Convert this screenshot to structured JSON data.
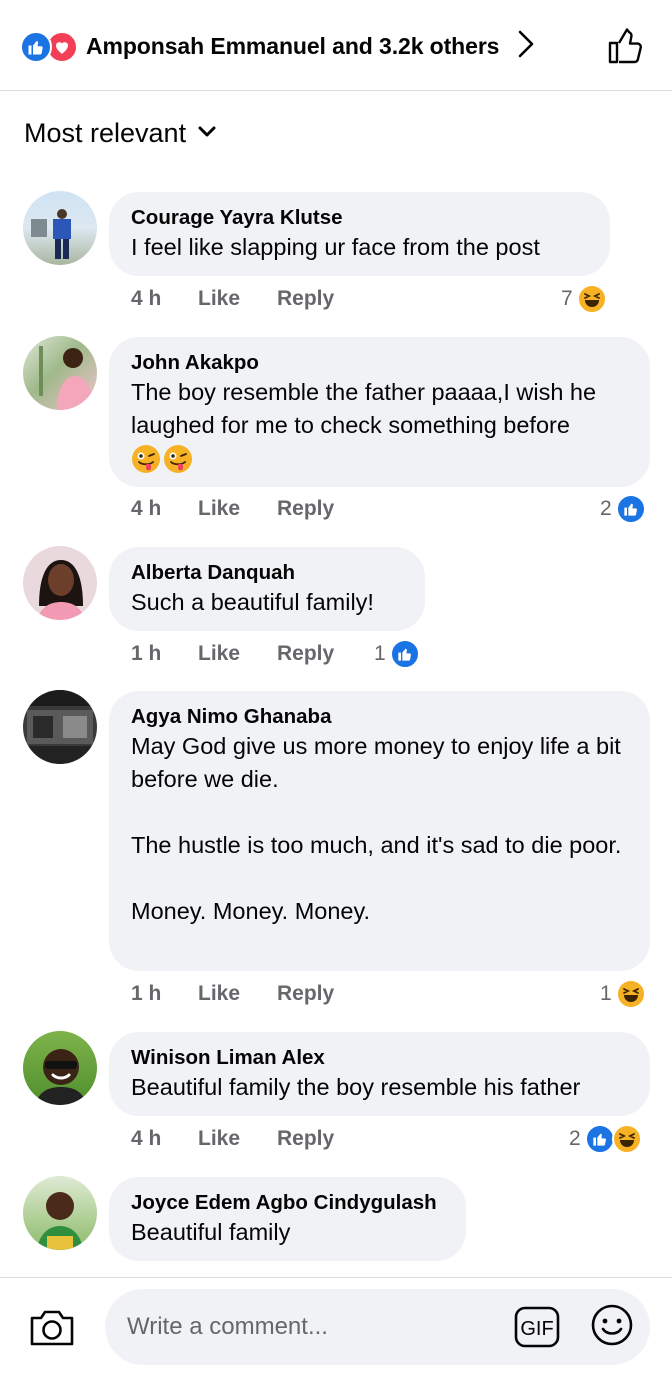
{
  "header": {
    "reactors_text": "Amponsah Emmanuel and 3.2k others",
    "reaction_icons": [
      "like-icon",
      "love-icon"
    ]
  },
  "sort": {
    "label": "Most relevant"
  },
  "comments": [
    {
      "author": "Courage Yayra Klutse",
      "text": "I feel like slapping ur face from the post",
      "time": "4 h",
      "like": "Like",
      "reply": "Reply",
      "reaction_count": "7",
      "reactions": [
        "haha-icon"
      ]
    },
    {
      "author": "John Akakpo",
      "text": "The boy resemble the father paaaa,I wish he laughed for me to check something before",
      "emoji_line": [
        "winking-tongue-icon",
        "winking-tongue-icon"
      ],
      "time": "4 h",
      "like": "Like",
      "reply": "Reply",
      "reaction_count": "2",
      "reactions": [
        "like-icon"
      ]
    },
    {
      "author": "Alberta Danquah",
      "text": "Such a beautiful family!",
      "time": "1 h",
      "like": "Like",
      "reply": "Reply",
      "reaction_count": "1",
      "reactions": [
        "like-icon"
      ]
    },
    {
      "author": "Agya Nimo Ghanaba",
      "text": "May God give us more money to enjoy life a bit before we die.\n\nThe hustle is too much, and it's sad to die poor.\n\nMoney. Money. Money.",
      "time": "1 h",
      "like": "Like",
      "reply": "Reply",
      "reaction_count": "1",
      "reactions": [
        "haha-icon"
      ]
    },
    {
      "author": "Winison Liman Alex",
      "text": "Beautiful family the boy resemble his father",
      "time": "4 h",
      "like": "Like",
      "reply": "Reply",
      "reaction_count": "2",
      "reactions": [
        "like-icon",
        "haha-icon"
      ]
    },
    {
      "author": "Joyce Edem Agbo Cindygulash",
      "text": "Beautiful family"
    }
  ],
  "composer": {
    "placeholder": "Write a comment...",
    "gif_label": "GIF"
  },
  "colors": {
    "like_blue": "#1b74e4",
    "love_red": "#f33e58",
    "haha_yellow": "#f7b125",
    "bubble_gray": "#f0f2f5",
    "meta_gray": "#65676b"
  }
}
